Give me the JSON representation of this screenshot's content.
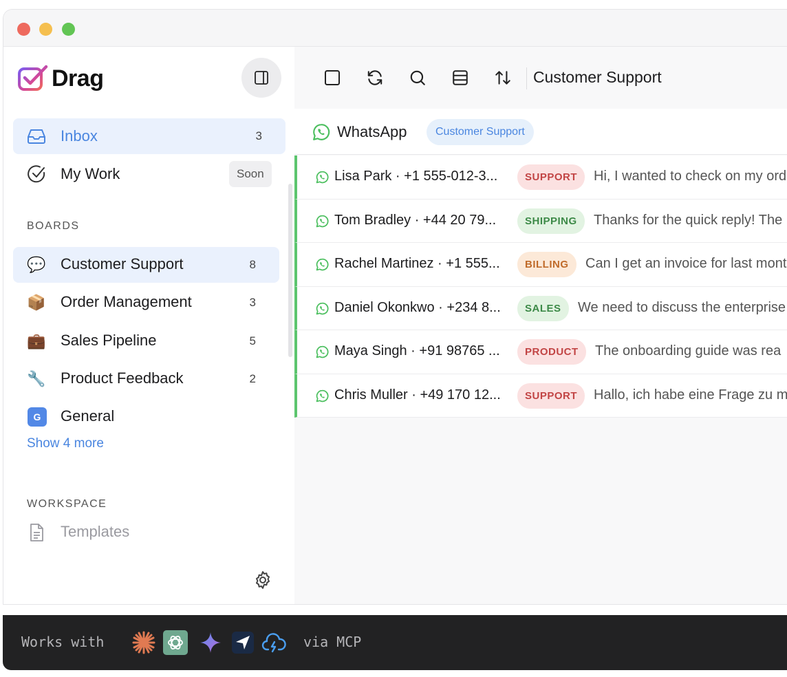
{
  "app": {
    "name": "Drag",
    "colors": {
      "accent": "#4a86e0",
      "whatsapp": "#4cbf5f",
      "active_bg": "#eaf1fd"
    }
  },
  "sidebar": {
    "nav": [
      {
        "label": "Inbox",
        "count": "3",
        "icon": "inbox-icon"
      },
      {
        "label": "My Work",
        "badge": "Soon",
        "icon": "check-circle-icon"
      }
    ],
    "boards_label": "BOARDS",
    "boards": [
      {
        "emoji": "💬",
        "label": "Customer Support",
        "count": "8"
      },
      {
        "emoji": "📦",
        "label": "Order Management",
        "count": "3"
      },
      {
        "emoji": "💼",
        "label": "Sales Pipeline",
        "count": "5"
      },
      {
        "emoji": "🔧",
        "label": "Product Feedback",
        "count": "2"
      },
      {
        "emoji": "G",
        "label": "General",
        "count": ""
      }
    ],
    "show_more": "Show 4 more",
    "workspace_label": "WORKSPACE",
    "workspace": [
      {
        "label": "Templates",
        "icon": "document-icon"
      }
    ]
  },
  "toolbar": {
    "icons": [
      "checkbox-icon",
      "refresh-icon",
      "search-icon",
      "layout-icon",
      "sort-icon"
    ],
    "title": "Customer Support"
  },
  "channel": {
    "name": "WhatsApp",
    "tag": "Customer Support"
  },
  "conversations": [
    {
      "who": "Lisa Park · +1 555-012-3...",
      "tag": "SUPPORT",
      "msg": "Hi, I wanted to check on my ord",
      "tag_bg": "#fbe1e1",
      "tag_fg": "#c24545"
    },
    {
      "who": "Tom Bradley · +44 20 79...",
      "tag": "SHIPPING",
      "msg": "Thanks for the quick reply! The",
      "tag_bg": "#e2f3e2",
      "tag_fg": "#3d8a48"
    },
    {
      "who": "Rachel Martinez · +1 555...",
      "tag": "BILLING",
      "msg": "Can I get an invoice for last mont",
      "tag_bg": "#fce9d8",
      "tag_fg": "#c06b2a"
    },
    {
      "who": "Daniel Okonkwo · +234 8...",
      "tag": "SALES",
      "msg": "We need to discuss the enterprise",
      "tag_bg": "#e2f3e2",
      "tag_fg": "#3d8a48"
    },
    {
      "who": "Maya Singh · +91 98765 ...",
      "tag": "PRODUCT",
      "msg": "The onboarding guide was rea",
      "tag_bg": "#fbe1e1",
      "tag_fg": "#c24545"
    },
    {
      "who": "Chris Muller · +49 170 12...",
      "tag": "SUPPORT",
      "msg": "Hallo, ich habe eine Frage zu m",
      "tag_bg": "#fbe1e1",
      "tag_fg": "#c24545"
    }
  ],
  "footer": {
    "prefix": "Works with",
    "suffix": "via MCP",
    "integrations": [
      "claude-icon",
      "chatgpt-icon",
      "gemini-icon",
      "cursor-icon",
      "cloud-icon"
    ]
  }
}
